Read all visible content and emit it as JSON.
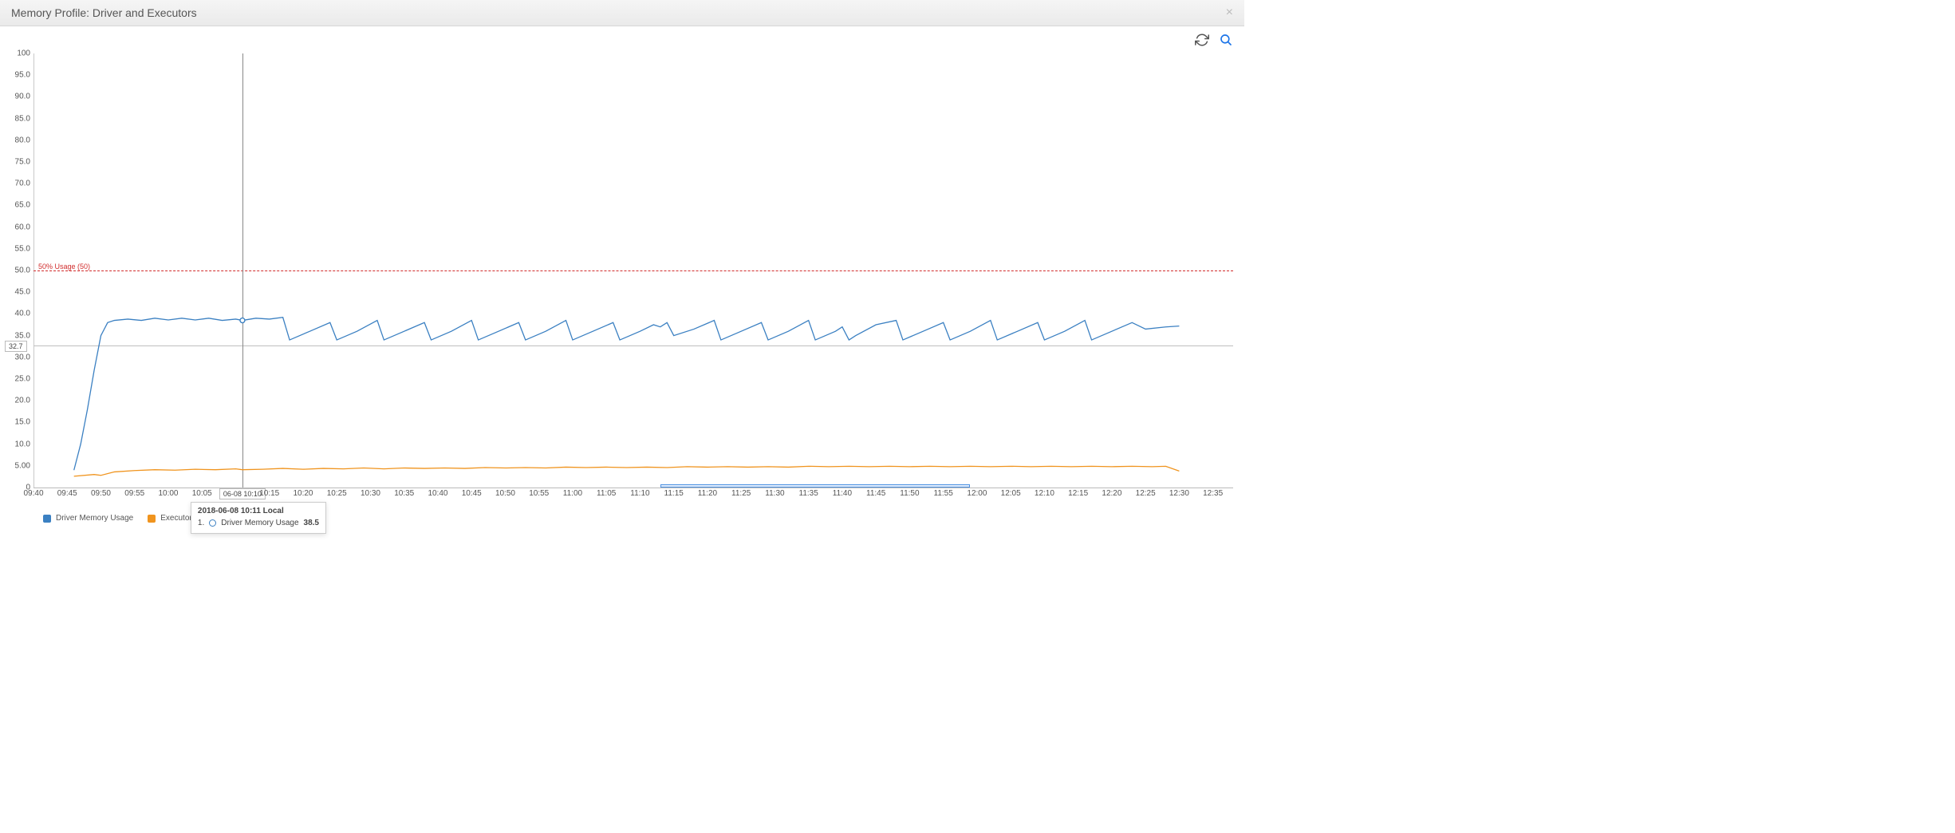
{
  "header": {
    "title": "Memory Profile: Driver and Executors",
    "close_icon": "×"
  },
  "toolbar": {
    "refresh_icon": "refresh",
    "zoom_icon": "zoom"
  },
  "chart_data": {
    "type": "line",
    "ylabel": "",
    "xlabel": "",
    "ylim": [
      0,
      100
    ],
    "y_ticks": [
      0,
      5,
      10,
      15,
      20,
      25,
      30,
      35,
      40,
      45,
      50,
      55,
      60,
      65,
      70,
      75,
      80,
      85,
      90,
      95,
      100
    ],
    "y_tick_labels": [
      "0",
      "5.00",
      "10.0",
      "15.0",
      "20.0",
      "25.0",
      "30.0",
      "35.0",
      "40.0",
      "45.0",
      "50.0",
      "55.0",
      "60.0",
      "65.0",
      "70.0",
      "75.0",
      "80.0",
      "85.0",
      "90.0",
      "95.0",
      "100"
    ],
    "x_range_minutes": [
      580,
      758
    ],
    "x_tick_times": [
      "09:40",
      "09:45",
      "09:50",
      "09:55",
      "10:00",
      "10:05",
      "10:15",
      "10:20",
      "10:25",
      "10:30",
      "10:35",
      "10:40",
      "10:45",
      "10:50",
      "10:55",
      "11:00",
      "11:05",
      "11:10",
      "11:15",
      "11:20",
      "11:25",
      "11:30",
      "11:35",
      "11:40",
      "11:45",
      "11:50",
      "11:55",
      "12:00",
      "12:05",
      "12:10",
      "12:15",
      "12:20",
      "12:25",
      "12:30",
      "12:35"
    ],
    "x_tick_minutes": [
      580,
      585,
      590,
      595,
      600,
      605,
      615,
      620,
      625,
      630,
      635,
      640,
      645,
      650,
      655,
      660,
      665,
      670,
      675,
      680,
      685,
      690,
      695,
      700,
      705,
      710,
      715,
      720,
      725,
      730,
      735,
      740,
      745,
      750,
      755
    ],
    "threshold": {
      "value": 50,
      "label": "50% Usage (50)"
    },
    "hover": {
      "x_minute": 611,
      "x_label": "06-08 10:10",
      "ref_y": 32.7,
      "tooltip_title": "2018-06-08 10:11 Local",
      "tooltip_rows": [
        {
          "index": "1.",
          "swatch": "driver",
          "label": "Driver Memory Usage",
          "value": "38.5"
        }
      ]
    },
    "selection_minutes": [
      673,
      719
    ],
    "series": [
      {
        "name": "Driver Memory Usage",
        "color": "#3b80c2",
        "points_minute_value": [
          [
            586,
            4
          ],
          [
            587,
            10
          ],
          [
            588,
            18
          ],
          [
            589,
            27
          ],
          [
            590,
            35
          ],
          [
            591,
            38
          ],
          [
            592,
            38.5
          ],
          [
            594,
            38.8
          ],
          [
            596,
            38.5
          ],
          [
            598,
            39
          ],
          [
            600,
            38.6
          ],
          [
            602,
            39
          ],
          [
            604,
            38.6
          ],
          [
            606,
            39
          ],
          [
            608,
            38.5
          ],
          [
            610,
            38.8
          ],
          [
            611,
            38.5
          ],
          [
            613,
            39
          ],
          [
            615,
            38.8
          ],
          [
            617,
            39.2
          ],
          [
            618,
            34
          ],
          [
            621,
            36
          ],
          [
            624,
            38
          ],
          [
            625,
            34
          ],
          [
            628,
            36
          ],
          [
            631,
            38.5
          ],
          [
            632,
            34
          ],
          [
            635,
            36
          ],
          [
            638,
            38
          ],
          [
            639,
            34
          ],
          [
            642,
            36
          ],
          [
            645,
            38.5
          ],
          [
            646,
            34
          ],
          [
            649,
            36
          ],
          [
            652,
            38
          ],
          [
            653,
            34
          ],
          [
            656,
            36
          ],
          [
            659,
            38.5
          ],
          [
            660,
            34
          ],
          [
            663,
            36
          ],
          [
            666,
            38
          ],
          [
            667,
            34
          ],
          [
            670,
            36
          ],
          [
            672,
            37.5
          ],
          [
            673,
            37
          ],
          [
            674,
            38
          ],
          [
            675,
            35
          ],
          [
            678,
            36.5
          ],
          [
            681,
            38.5
          ],
          [
            682,
            34
          ],
          [
            685,
            36
          ],
          [
            688,
            38
          ],
          [
            689,
            34
          ],
          [
            692,
            36
          ],
          [
            695,
            38.5
          ],
          [
            696,
            34
          ],
          [
            699,
            36
          ],
          [
            700,
            37
          ],
          [
            701,
            34
          ],
          [
            702,
            35
          ],
          [
            705,
            37.5
          ],
          [
            708,
            38.5
          ],
          [
            709,
            34
          ],
          [
            712,
            36
          ],
          [
            715,
            38
          ],
          [
            716,
            34
          ],
          [
            719,
            36
          ],
          [
            722,
            38.5
          ],
          [
            723,
            34
          ],
          [
            726,
            36
          ],
          [
            729,
            38
          ],
          [
            730,
            34
          ],
          [
            733,
            36
          ],
          [
            736,
            38.5
          ],
          [
            737,
            34
          ],
          [
            740,
            36
          ],
          [
            743,
            38
          ],
          [
            745,
            36.5
          ],
          [
            748,
            37
          ],
          [
            750,
            37.2
          ]
        ]
      },
      {
        "name": "Executor Memory Usage",
        "color": "#f0941e",
        "points_minute_value": [
          [
            586,
            2.6
          ],
          [
            589,
            3.0
          ],
          [
            590,
            2.8
          ],
          [
            592,
            3.6
          ],
          [
            595,
            3.9
          ],
          [
            598,
            4.1
          ],
          [
            601,
            4.0
          ],
          [
            604,
            4.2
          ],
          [
            607,
            4.1
          ],
          [
            610,
            4.3
          ],
          [
            611,
            4.1
          ],
          [
            614,
            4.2
          ],
          [
            617,
            4.4
          ],
          [
            620,
            4.2
          ],
          [
            623,
            4.4
          ],
          [
            626,
            4.3
          ],
          [
            629,
            4.5
          ],
          [
            632,
            4.3
          ],
          [
            635,
            4.5
          ],
          [
            638,
            4.4
          ],
          [
            641,
            4.5
          ],
          [
            644,
            4.4
          ],
          [
            647,
            4.6
          ],
          [
            650,
            4.5
          ],
          [
            653,
            4.6
          ],
          [
            656,
            4.5
          ],
          [
            659,
            4.7
          ],
          [
            662,
            4.6
          ],
          [
            665,
            4.7
          ],
          [
            668,
            4.6
          ],
          [
            671,
            4.7
          ],
          [
            674,
            4.6
          ],
          [
            677,
            4.8
          ],
          [
            680,
            4.7
          ],
          [
            683,
            4.8
          ],
          [
            686,
            4.7
          ],
          [
            689,
            4.8
          ],
          [
            692,
            4.7
          ],
          [
            695,
            4.9
          ],
          [
            698,
            4.8
          ],
          [
            701,
            4.9
          ],
          [
            704,
            4.8
          ],
          [
            707,
            4.9
          ],
          [
            710,
            4.8
          ],
          [
            713,
            4.9
          ],
          [
            716,
            4.8
          ],
          [
            719,
            4.9
          ],
          [
            722,
            4.8
          ],
          [
            725,
            4.9
          ],
          [
            728,
            4.8
          ],
          [
            731,
            4.9
          ],
          [
            734,
            4.8
          ],
          [
            737,
            4.9
          ],
          [
            740,
            4.8
          ],
          [
            743,
            4.9
          ],
          [
            746,
            4.8
          ],
          [
            748,
            4.9
          ],
          [
            750,
            3.8
          ]
        ]
      }
    ]
  },
  "legend": {
    "items": [
      {
        "label": "Driver Memory Usage",
        "color": "#3b80c2"
      },
      {
        "label": "Executor Memory Usage",
        "color": "#f0941e"
      }
    ]
  }
}
